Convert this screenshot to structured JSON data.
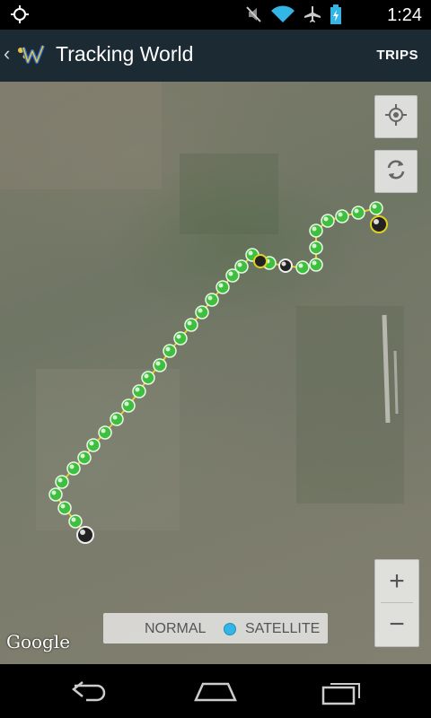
{
  "status_bar": {
    "time": "1:24",
    "icons": [
      "gps-icon",
      "mute-icon",
      "wifi-icon",
      "airplane-icon",
      "battery-icon"
    ]
  },
  "action_bar": {
    "title": "Tracking World",
    "action": "TRIPS",
    "logo": "TW"
  },
  "map": {
    "type_options": [
      "NORMAL",
      "SATELLITE"
    ],
    "selected_type": "SATELLITE",
    "attribution": "Google",
    "zoom_in": "+",
    "zoom_out": "−",
    "accent_color": "#33b5e5",
    "track_color": "#3fbf3f"
  },
  "nav_bar": {
    "buttons": [
      "back-icon",
      "home-icon",
      "recent-apps-icon"
    ]
  }
}
